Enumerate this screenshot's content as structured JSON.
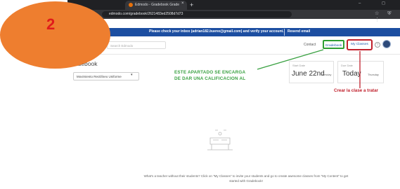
{
  "browser": {
    "tab_title": "Edmodo - Gradebook Grade",
    "url": "edmodo.com/gradebook/2621483ed2508d7d73",
    "new_tab_symbol": "+",
    "tab_close_symbol": "×",
    "window_controls": "–  ◻  ×",
    "nav_symbols": "⌂",
    "ext_symbols": "☆ ⛨ ⋮"
  },
  "banner": {
    "message": "Please check your inbox (adrian182.bueno@gmail.com) and verify your account.",
    "resend_label": "Resend email"
  },
  "header": {
    "logo_text": "zle",
    "search_placeholder": "Search Edmodo",
    "contact_label": "Contact",
    "gradebook_label": "Gradebook",
    "my_classes_label": "My Classes",
    "help_symbol": "?"
  },
  "page": {
    "title": "radebook",
    "class_select_value": "Movimiento Rectilíneo Uniforme",
    "class_select_caret": "▾"
  },
  "cards": {
    "start": {
      "label": "Start Date",
      "value": "June 22nd",
      "sub": "Tuesday"
    },
    "due": {
      "label": "Due Date",
      "value": "Today",
      "sub": "Thursday"
    }
  },
  "annotations": {
    "gradebook_note": "ESTE APARTADO SE ENCARGA DE DAR UNA CALIFICACION AL",
    "myclasses_note": "Crear la clase a tratar",
    "step_number": "2",
    "colors": {
      "green": "#2e9e34",
      "red": "#c0202c",
      "badge": "#ee7e2f"
    }
  },
  "empty_state": {
    "text": "What's a teacher without their students? Click on \"My Classes\" to invite your students and go to create awesome classes from \"My Content\" to get started with Gradebook!"
  }
}
